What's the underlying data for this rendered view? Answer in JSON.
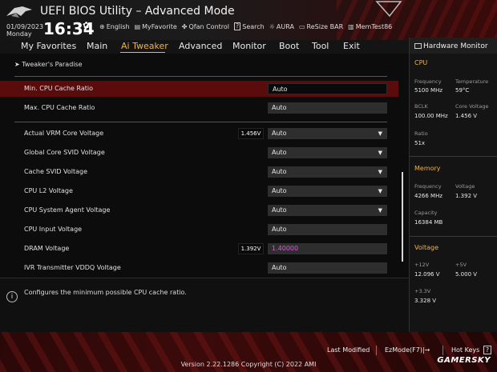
{
  "header": {
    "title": "UEFI BIOS Utility – Advanced Mode",
    "date": "01/09/2023",
    "day": "Monday",
    "time": "16:34",
    "items": [
      {
        "icon": "globe-icon",
        "glyph": "⊕",
        "label": "English"
      },
      {
        "icon": "favorite-icon",
        "glyph": "▤",
        "label": "MyFavorite"
      },
      {
        "icon": "fan-icon",
        "glyph": "✤",
        "label": "Qfan Control"
      },
      {
        "icon": "help-box-icon",
        "glyph": "?",
        "label": "Search"
      },
      {
        "icon": "aura-icon",
        "glyph": "☼",
        "label": "AURA"
      },
      {
        "icon": "resize-bar-icon",
        "glyph": "▭",
        "label": "ReSize BAR"
      },
      {
        "icon": "memtest-icon",
        "glyph": "▥",
        "label": "MemTest86"
      }
    ]
  },
  "nav": {
    "tabs": [
      "My Favorites",
      "Main",
      "Ai Tweaker",
      "Advanced",
      "Monitor",
      "Boot",
      "Tool",
      "Exit"
    ],
    "active": "Ai Tweaker"
  },
  "main": {
    "breadcrumb": "Tweaker's Paradise",
    "rows": [
      {
        "label": "Min. CPU Cache Ratio",
        "value": "Auto",
        "selected": true
      },
      {
        "label": "Max. CPU Cache Ratio",
        "value": "Auto"
      },
      {
        "label": "Actual VRM Core Voltage",
        "current": "1.456V",
        "value": "Auto",
        "dropdown": true
      },
      {
        "label": "Global Core SVID Voltage",
        "value": "Auto",
        "dropdown": true
      },
      {
        "label": "Cache SVID Voltage",
        "value": "Auto",
        "dropdown": true
      },
      {
        "label": "CPU L2 Voltage",
        "value": "Auto",
        "dropdown": true
      },
      {
        "label": "CPU System Agent Voltage",
        "value": "Auto",
        "dropdown": true
      },
      {
        "label": "CPU Input Voltage",
        "value": "Auto"
      },
      {
        "label": "DRAM Voltage",
        "current": "1.392V",
        "value": "1.40000"
      },
      {
        "label": "IVR Transmitter VDDQ Voltage",
        "value": "Auto"
      }
    ]
  },
  "help": {
    "text": "Configures the minimum possible CPU cache ratio."
  },
  "hw_monitor": {
    "title": "Hardware Monitor",
    "cpu": {
      "section": "CPU",
      "frequency_label": "Frequency",
      "frequency": "5100 MHz",
      "temperature_label": "Temperature",
      "temperature": "59°C",
      "bclk_label": "BCLK",
      "bclk": "100.00 MHz",
      "core_voltage_label": "Core Voltage",
      "core_voltage": "1.456 V",
      "ratio_label": "Ratio",
      "ratio": "51x"
    },
    "memory": {
      "section": "Memory",
      "frequency_label": "Frequency",
      "frequency": "4266 MHz",
      "voltage_label": "Voltage",
      "voltage": "1.392 V",
      "capacity_label": "Capacity",
      "capacity": "16384 MB"
    },
    "voltage": {
      "section": "Voltage",
      "v12_label": "+12V",
      "v12": "12.096 V",
      "v5_label": "+5V",
      "v5": "5.000 V",
      "v33_label": "+3.3V",
      "v33": "3.328 V"
    }
  },
  "footer": {
    "last_modified": "Last Modified",
    "ezmode": "EzMode(F7)|→",
    "hot_keys": "Hot Keys",
    "hot_keys_icon": "?",
    "version": "Version 2.22.1286 Copyright (C) 2022 AMI",
    "watermark": "GAMERSKY"
  },
  "colors": {
    "accent": "#f0b24a",
    "selected_row": "#5a0b0b",
    "header_red": "#3a0a0a",
    "pink_value": "#d85ad8"
  }
}
